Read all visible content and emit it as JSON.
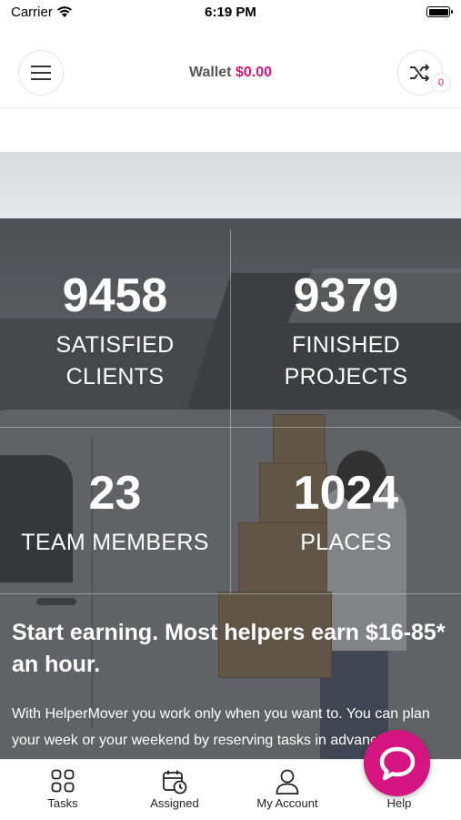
{
  "status_bar": {
    "carrier": "Carrier",
    "time": "6:19 PM"
  },
  "header": {
    "menu_icon": "hamburger-menu-icon",
    "wallet_label": "Wallet",
    "wallet_amount": "$0.00",
    "shuffle_icon": "shuffle-icon",
    "notification_count": "0"
  },
  "stats": [
    {
      "number": "9458",
      "label_line1": "SATISFIED",
      "label_line2": "CLIENTS"
    },
    {
      "number": "9379",
      "label_line1": "FINISHED",
      "label_line2": "PROJECTS"
    },
    {
      "number": "23",
      "label_line1": "TEAM MEMBERS",
      "label_line2": ""
    },
    {
      "number": "1024",
      "label_line1": "PLACES",
      "label_line2": ""
    }
  ],
  "promo": {
    "headline": "Start earning. Most helpers earn $16-85* an hour.",
    "body": "With HelperMover you work only when you want to. You can plan your week or your weekend by reserving tasks in advance or"
  },
  "tab_bar": [
    {
      "label": "Tasks",
      "icon": "grid-icon"
    },
    {
      "label": "Assigned",
      "icon": "calendar-clock-icon"
    },
    {
      "label": "My Account",
      "icon": "user-icon"
    },
    {
      "label": "Help",
      "icon": "chat-bubble-icon"
    }
  ],
  "colors": {
    "accent": "#d4147f",
    "text": "#222222"
  }
}
